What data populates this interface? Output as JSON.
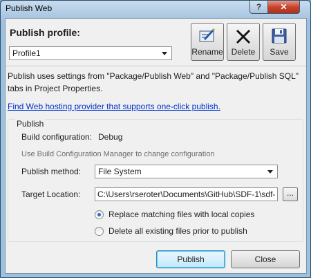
{
  "window": {
    "title": "Publish Web",
    "help_label": "?",
    "close_label": "✕"
  },
  "profile": {
    "label": "Publish profile:",
    "selected": "Profile1"
  },
  "toolbar": {
    "rename_label": "Rename",
    "delete_label": "Delete",
    "save_label": "Save"
  },
  "description": "Publish uses settings from \"Package/Publish Web\" and \"Package/Publish SQL\" tabs in Project Properties.",
  "hosting_link": "Find Web hosting provider that supports one-click publish.",
  "publish_group": {
    "title": "Publish",
    "build_config_label": "Build configuration:",
    "build_config_value": "Debug",
    "build_config_hint": "Use Build Configuration Manager to change configuration",
    "method_label": "Publish method:",
    "method_value": "File System",
    "target_label": "Target Location:",
    "target_value": "C:\\Users\\rseroter\\Documents\\GitHub\\SDF-1\\sdf-",
    "browse_label": "...",
    "options": [
      {
        "label": "Replace matching files with local copies",
        "checked": true
      },
      {
        "label": "Delete all existing files prior to publish",
        "checked": false
      }
    ]
  },
  "footer": {
    "publish_label": "Publish",
    "close_label": "Close"
  },
  "icons": {
    "rename": "rename-icon",
    "delete": "delete-x-icon",
    "save": "floppy-disk-icon"
  }
}
